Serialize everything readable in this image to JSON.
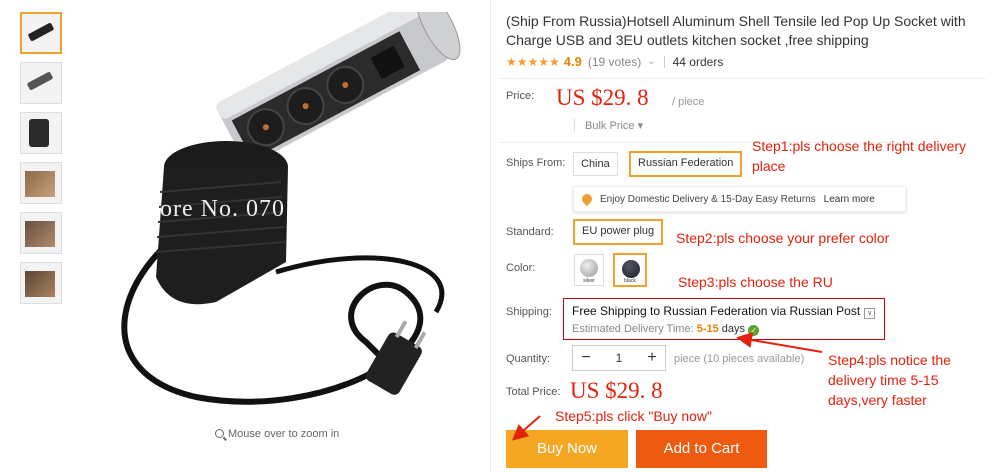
{
  "product": {
    "title": "(Ship From Russia)Hotsell Aluminum Shell Tensile led Pop Up Socket with Charge USB and 3EU outlets kitchen socket ,free shipping",
    "stars": "★★★★★",
    "rating": "4.9",
    "votes": "(19 votes)",
    "orders": "44 orders"
  },
  "image": {
    "watermark": "Store No.  0701",
    "zoom_hint": "Mouse over to zoom in"
  },
  "price": {
    "label": "Price:",
    "value": "US  $29. 8",
    "per_piece": "/ piece",
    "bulk": "Bulk Price ▾"
  },
  "ships_from": {
    "label": "Ships From:",
    "options": [
      "China",
      "Russian Federation"
    ],
    "selected": "Russian Federation",
    "delivery_note": "Enjoy Domestic Delivery & 15-Day Easy Returns",
    "learn_more": "Learn more"
  },
  "standard": {
    "label": "Standard:",
    "value": "EU power plug"
  },
  "color": {
    "label": "Color:",
    "options": [
      {
        "name": "silver",
        "hex": "#b8b8b8"
      },
      {
        "name": "black",
        "hex": "#2a3138"
      }
    ],
    "selected": "black"
  },
  "shipping": {
    "label": "Shipping:",
    "main_prefix": "Free Shipping",
    "main_rest": " to Russian Federation via Russian Post",
    "est_label": "Estimated Delivery Time: ",
    "days_num": "5-15",
    "days_word": " days"
  },
  "quantity": {
    "label": "Quantity:",
    "minus": "−",
    "value": "1",
    "plus": "+",
    "note": "piece (10 pieces available)"
  },
  "total": {
    "label": "Total Price:",
    "value": "US  $29. 8"
  },
  "buttons": {
    "buy_now": "Buy Now",
    "add_to_cart": "Add to Cart"
  },
  "annotations": {
    "step1": "Step1:pls choose the right delivery place",
    "step2": "Step2:pls choose your prefer color",
    "step3": "Step3:pls choose the RU",
    "step4": "Step4:pls notice the delivery time 5-15 days,very faster",
    "step5": "Step5:pls click \"Buy now\""
  },
  "colors": {
    "accent_orange": "#f0a030",
    "annotation_red": "#e4210d",
    "buy_now_bg": "#f5a623",
    "add_to_cart_bg": "#ee5a0f"
  }
}
